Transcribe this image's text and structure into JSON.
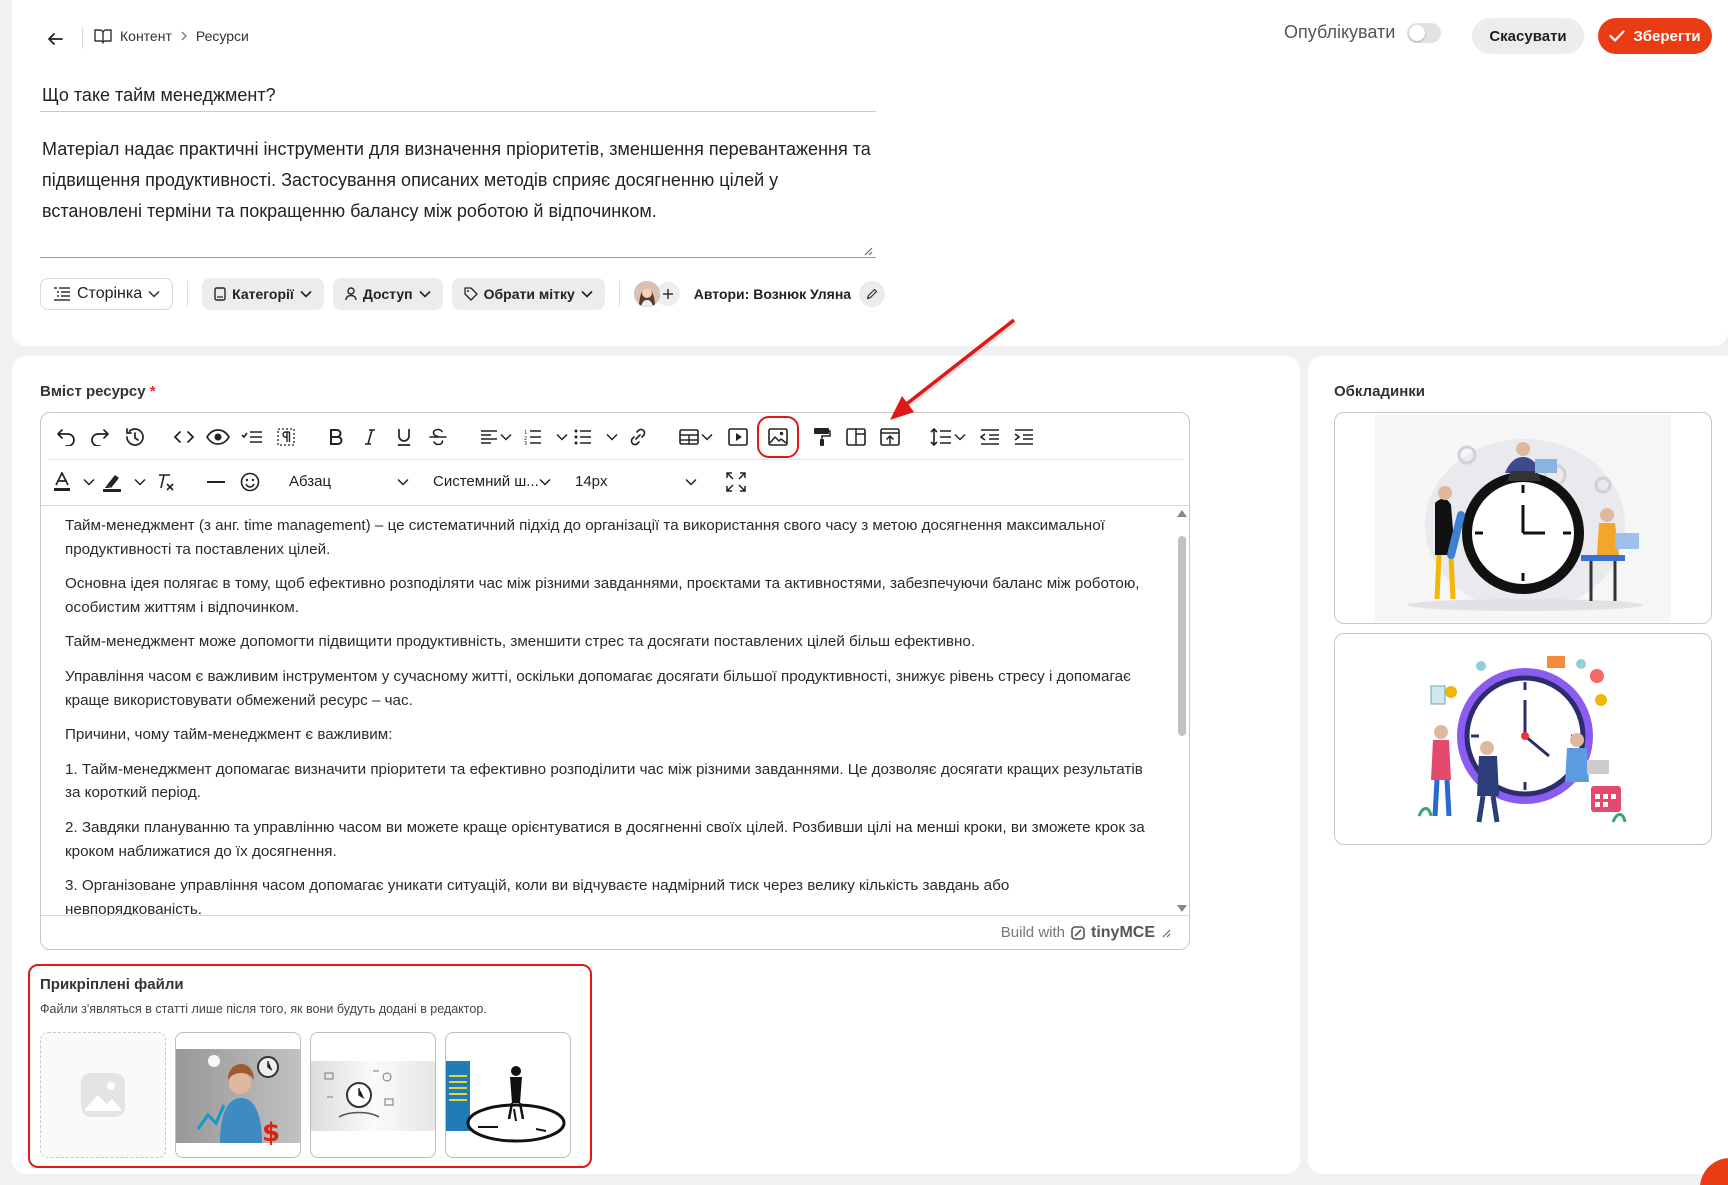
{
  "header": {
    "breadcrumb": [
      "Контент",
      "Ресурси"
    ],
    "publish_label": "Опублікувати",
    "cancel_label": "Скасувати",
    "save_label": "Зберегти"
  },
  "resource": {
    "title": "Що таке тайм менеджмент?",
    "description": "Матеріал надає практичні інструменти для визначення пріоритетів, зменшення перевантаження та підвищення продуктивності. Застосування описаних методів сприяє досягненню цілей у встановлені терміни та покращенню балансу між роботою й відпочинком."
  },
  "meta": {
    "page_type": "Сторінка",
    "category": "Категорії",
    "access": "Доступ",
    "tag": "Обрати мітку",
    "authors": "Автори: Вознюк Уляна"
  },
  "content_section": {
    "label": "Вміст ресурсу",
    "required_mark": "*"
  },
  "toolbar": {
    "paragraph": "Абзац",
    "font_family": "Системний ш...",
    "font_size": "14px"
  },
  "editor": {
    "paragraphs": [
      "Тайм-менеджмент (з анг. time management) – це систематичний підхід до організації та використання свого часу з метою досягнення максимальної продуктивності та поставлених цілей.",
      "Основна ідея полягає в тому, щоб ефективно розподіляти час між різними завданнями, проєктами та активностями, забезпечуючи баланс між роботою, особистим життям і відпочинком.",
      "Тайм-менеджмент може допомогти підвищити продуктивність, зменшити стрес та досягати поставлених цілей більш ефективно.",
      "Управління часом є важливим інструментом у сучасному житті, оскільки допомагає досягати більшої продуктивності, знижує рівень стресу і допомагає краще використовувати обмежений ресурс – час.",
      "Причини, чому тайм-менеджмент є важливим:",
      "1. Тайм-менеджмент допомагає визначити пріоритети та ефективно розподілити час між різними завданнями. Це дозволяє досягати кращих результатів за короткий період.",
      "2. Завдяки плануванню та управлінню часом ви можете краще орієнтуватися в досягненні своїх цілей. Розбивши цілі на менші кроки, ви зможете крок за кроком наближатися до їх досягнення.",
      "3. Організоване управління часом допомагає уникати ситуацій, коли ви відчуваєте надмірний тиск через велику кількість завдань або невпорядкованість."
    ],
    "status_prefix": "Build with",
    "status_brand": "tinyMCE"
  },
  "attached": {
    "title": "Прикріплені файли",
    "subtitle": "Файли з'являться в статті лише після того, як вони будуть додані в редактор."
  },
  "covers": {
    "label": "Обкладинки"
  },
  "colors": {
    "accent": "#ea3c14",
    "highlight": "#e01818"
  }
}
